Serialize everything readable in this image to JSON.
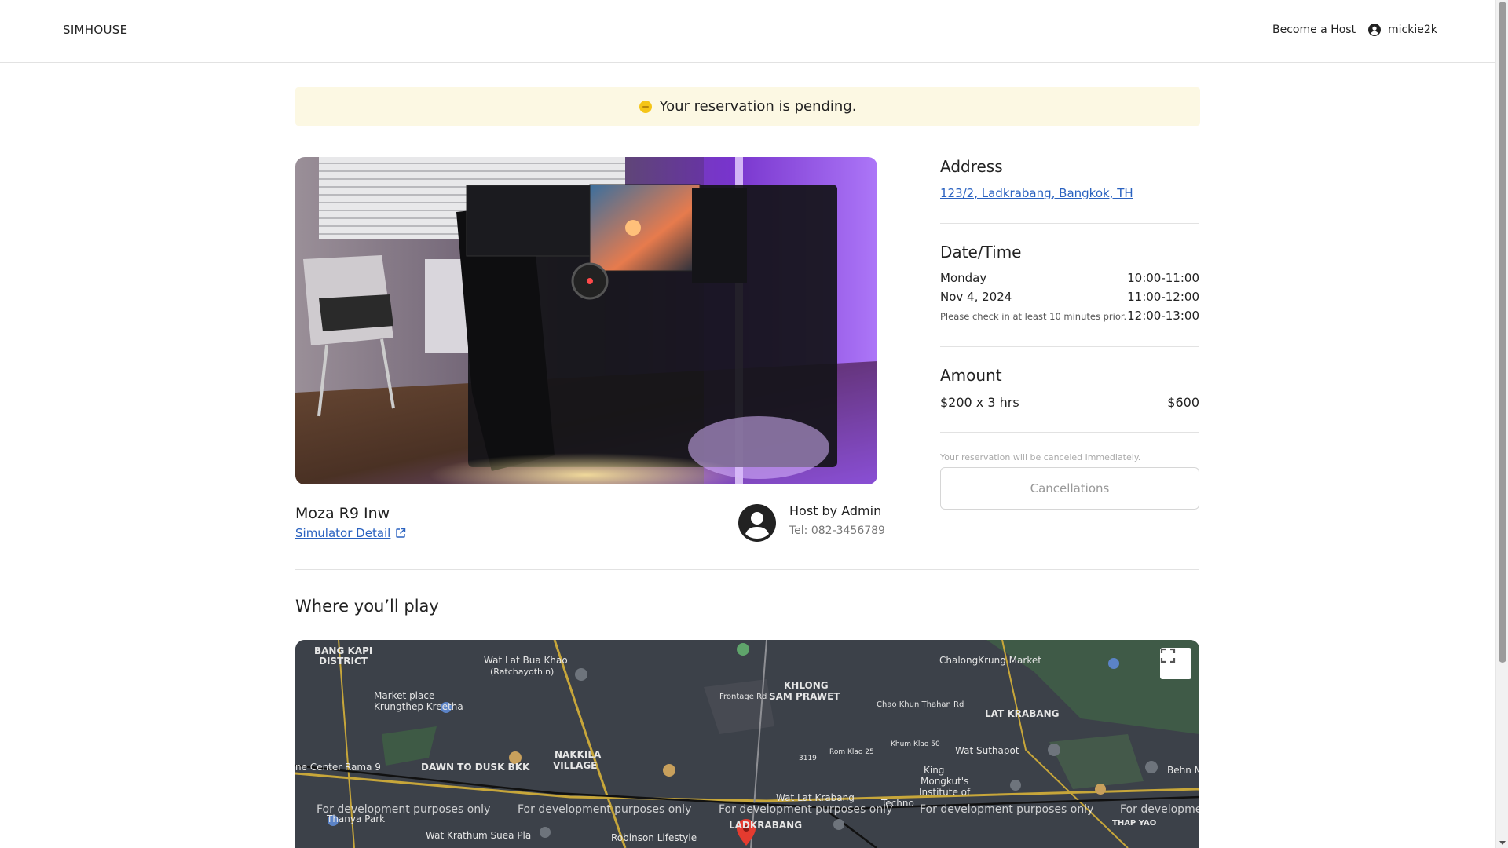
{
  "header": {
    "logo": "SIMHOUSE",
    "become_host": "Become a Host",
    "username": "mickie2k"
  },
  "banner": {
    "text": "Your reservation is pending.",
    "color": "#fcf8e3"
  },
  "simulator": {
    "name": "Moza R9 Inw",
    "detail_link": "Simulator Detail"
  },
  "host": {
    "name": "Host by Admin",
    "tel": "Tel: 082-3456789"
  },
  "address": {
    "title": "Address",
    "value": "123/2, Ladkrabang, Bangkok, TH"
  },
  "datetime": {
    "title": "Date/Time",
    "day": "Monday",
    "date": "Nov 4, 2024",
    "note": "Please check in at least 10 minutes prior.",
    "slots": [
      "10:00-11:00",
      "11:00-12:00",
      "12:00-13:00"
    ]
  },
  "amount": {
    "title": "Amount",
    "breakdown": "$200 x 3 hrs",
    "total": "$600"
  },
  "cancellation": {
    "note": "Your reservation will be canceled immediately.",
    "button": "Cancellations"
  },
  "where": {
    "title": "Where you’ll play"
  },
  "map": {
    "labels": {
      "bang_kapi": "BANG KAPI",
      "district": "DISTRICT",
      "wat_lat_bua_khao": "Wat Lat Bua Khao",
      "ratchayothin": "(Ratchayothin)",
      "khlong": "KHLONG",
      "sam_prawet": "SAM PRAWET",
      "market_place": "Market place",
      "krungthep_kreetha": "Krungthep Kreetha",
      "center_rama9": "ne Center Rama 9",
      "dawn_to_dusk": "DAWN TO DUSK BKK",
      "nakkila": "NAKKILA",
      "village": "VILLAGE",
      "frontage_rd": "Frontage Rd",
      "chao_khun": "Chao Khun Thahan Rd",
      "chalongkrung_market": "ChalongKrung Market",
      "lat_krabang": "LAT KRABANG",
      "rom_klao": "Rom Klao 25",
      "khum_klao": "Khum Klao 50",
      "wat_suthapot": "Wat Suthapot",
      "king_mongkut": "King",
      "mongkut": "Mongkut's",
      "institute": "Institute of",
      "techno": "Techno",
      "behn_meyer": "Behn Meyer Co., Ltd",
      "wat_lat_krabang": "Wat Lat Krabang",
      "wat_krathum": "Wat Krathum Suea Pla",
      "thanya_park": "Thanya Park",
      "robinson": "Robinson Lifestyle",
      "ladkrabang": "LADKRABANG",
      "thap_yao": "THAP YAO",
      "route_3119": "3119",
      "dev_only": "For development purposes only",
      "dev_only_cut": "For developme"
    }
  }
}
